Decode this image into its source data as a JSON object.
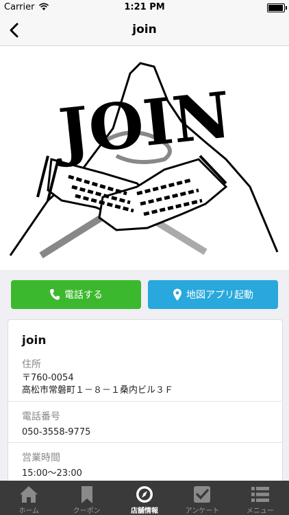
{
  "status": {
    "carrier": "Carrier",
    "time": "1:21 PM"
  },
  "nav": {
    "title": "join"
  },
  "hero": {
    "logo_text": "JOIN"
  },
  "actions": {
    "phone_label": "電話する",
    "map_label": "地図アプリ起動"
  },
  "shop": {
    "name": "join",
    "address_label": "住所",
    "address_line1": "〒760-0054",
    "address_line2": "高松市常磐町１－８－１桑内ビル３Ｆ",
    "phone_label": "電話番号",
    "phone_value": "050-3558-9775",
    "hours_label": "営業時間",
    "hours_value": "15:00〜23:00"
  },
  "tabs": [
    {
      "label": "ホーム",
      "icon": "home-icon"
    },
    {
      "label": "クーポン",
      "icon": "bookmark-icon"
    },
    {
      "label": "店舗情報",
      "icon": "compass-icon",
      "active": true
    },
    {
      "label": "アンケート",
      "icon": "checkbox-icon"
    },
    {
      "label": "メニュー",
      "icon": "list-icon"
    }
  ],
  "colors": {
    "phone_button": "#3bb82e",
    "map_button": "#28a8dc",
    "tab_bar": "#3a3a3a"
  }
}
